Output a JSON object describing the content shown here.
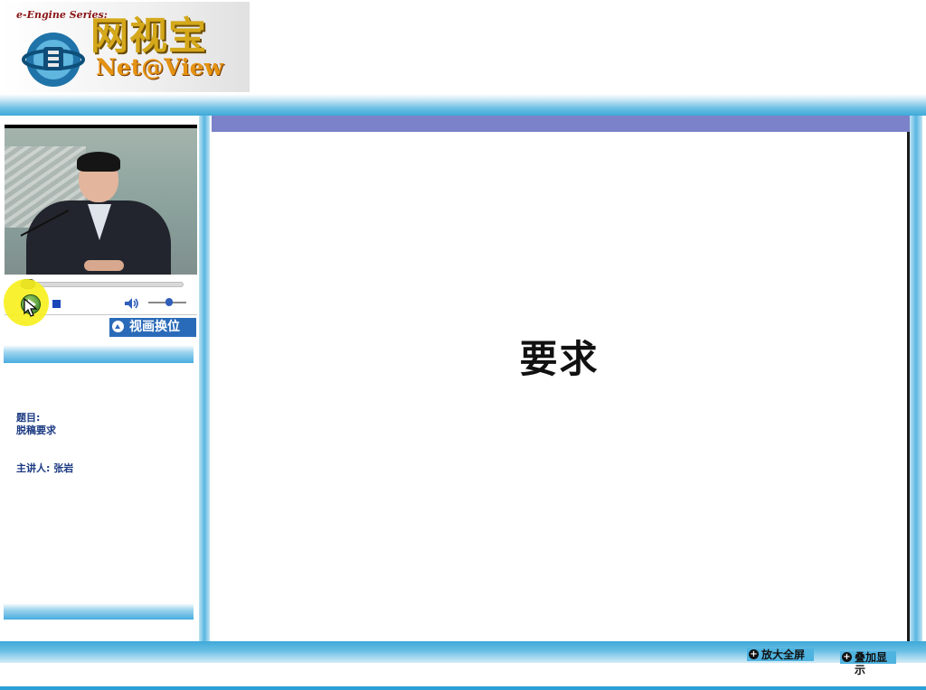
{
  "header": {
    "series_label": "e-Engine Series:",
    "brand_cn": "网视宝",
    "brand_en": "Net@View"
  },
  "player": {
    "swap_label": "视画换位",
    "seek_progress": 0.05,
    "volume_level": 0.55
  },
  "info": {
    "topic_label": "题目:",
    "topic_value": "脱稿要求",
    "speaker_label": "主讲人:",
    "speaker_name": "张岩"
  },
  "slide": {
    "text": "要求"
  },
  "footer": {
    "fullscreen_label": "放大全屏",
    "overlay_label": "叠加显示"
  },
  "colors": {
    "accent_blue": "#3ea9d8",
    "slide_bar": "#7b82c9",
    "text_navy": "#1d3b84",
    "highlight": "#f7f01f"
  }
}
